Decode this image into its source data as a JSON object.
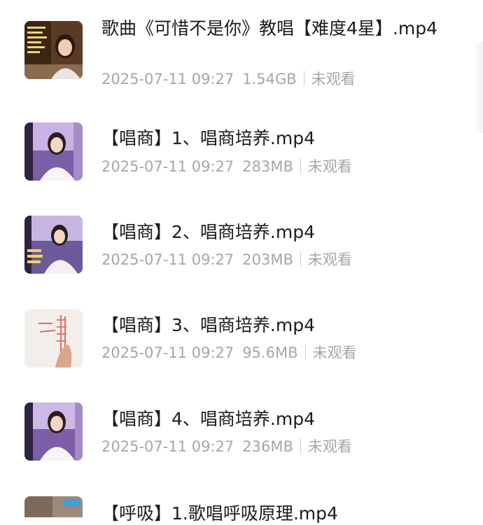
{
  "files": [
    {
      "title": "歌曲《可惜不是你》教唱【难度4星】.mp4",
      "date": "2025-07-11 09:27",
      "size": "1.54GB",
      "status": "未观看",
      "thumb_icon": "teacher-video-thumbnail"
    },
    {
      "title": "【唱商】1、唱商培养.mp4",
      "date": "2025-07-11 09:27",
      "size": "283MB",
      "status": "未观看",
      "thumb_icon": "teacher-video-thumbnail"
    },
    {
      "title": "【唱商】2、唱商培养.mp4",
      "date": "2025-07-11 09:27",
      "size": "203MB",
      "status": "未观看",
      "thumb_icon": "teacher-video-thumbnail"
    },
    {
      "title": "【唱商】3、唱商培养.mp4",
      "date": "2025-07-11 09:27",
      "size": "95.6MB",
      "status": "未观看",
      "thumb_icon": "diagram-video-thumbnail"
    },
    {
      "title": "【唱商】4、唱商培养.mp4",
      "date": "2025-07-11 09:27",
      "size": "236MB",
      "status": "未观看",
      "thumb_icon": "teacher-video-thumbnail"
    },
    {
      "title": "【呼吸】1.歌唱呼吸原理.mp4",
      "thumb_icon": "video-thumbnail"
    }
  ]
}
